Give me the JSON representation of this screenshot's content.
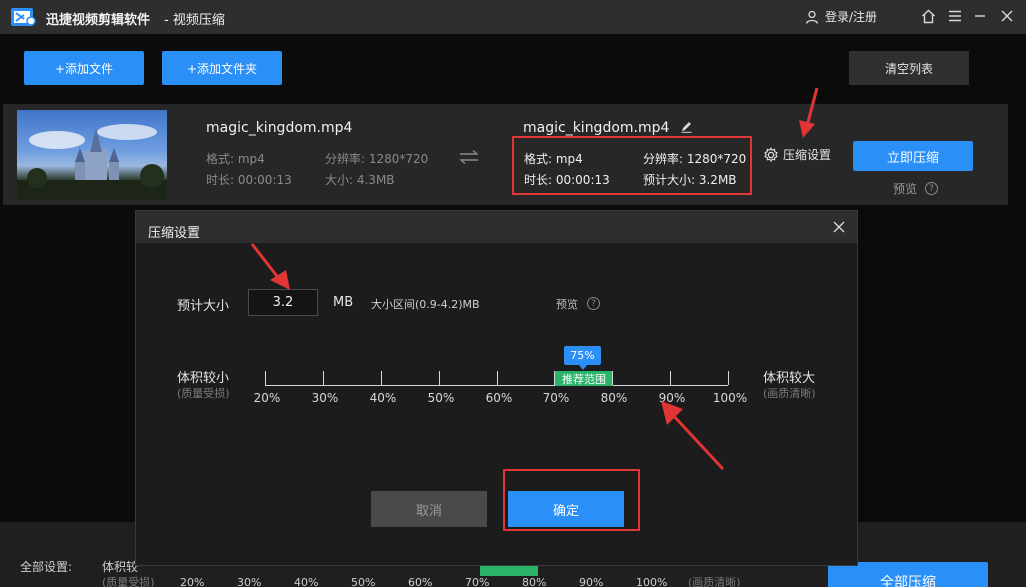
{
  "titlebar": {
    "app_title": "迅捷视频剪辑软件",
    "subtitle": "- 视频压缩",
    "login_label": "登录/注册",
    "icons": [
      "user-icon",
      "home-icon",
      "menu-icon",
      "minimize-icon",
      "close-icon"
    ]
  },
  "toolbar": {
    "add_file": "+添加文件",
    "add_folder": "+添加文件夹",
    "clear_list": "清空列表"
  },
  "file": {
    "source": {
      "name": "magic_kingdom.mp4",
      "format": "格式: mp4",
      "duration": "时长: 00:00:13",
      "resolution": "分辨率: 1280*720",
      "size": "大小: 4.3MB"
    },
    "output": {
      "name": "magic_kingdom.mp4",
      "format": "格式: mp4",
      "duration": "时长: 00:00:13",
      "resolution": "分辨率: 1280*720",
      "est_size": "预计大小: 3.2MB"
    },
    "settings_label": "压缩设置",
    "compress_now": "立即压缩",
    "preview": "预览"
  },
  "dialog": {
    "title": "压缩设置",
    "est_size_label": "预计大小",
    "est_size_value": "3.2",
    "unit": "MB",
    "range_text": "大小区间(0.9-4.2)MB",
    "preview": "预览",
    "slider": {
      "left_label": "体积较小",
      "left_sub": "(质量受损)",
      "right_label": "体积较大",
      "right_sub": "(画质清晰)",
      "ticks": [
        "20%",
        "30%",
        "40%",
        "50%",
        "60%",
        "70%",
        "80%",
        "90%",
        "100%"
      ],
      "current": "75%",
      "current_value": 75,
      "recommend_label": "推荐范围"
    },
    "cancel": "取消",
    "confirm": "确定"
  },
  "bottom": {
    "global_settings": "全部设置:",
    "left_label": "体积较",
    "left_sub": "(质量受损)",
    "right_sub": "(画质清晰)",
    "ticks": [
      "20%",
      "30%",
      "40%",
      "50%",
      "60%",
      "70%",
      "80%",
      "90%",
      "100%"
    ],
    "compress_all": "全部压缩"
  },
  "colors": {
    "accent": "#2a8ff7",
    "recommend": "#2bb36a",
    "highlight": "#e13434"
  }
}
